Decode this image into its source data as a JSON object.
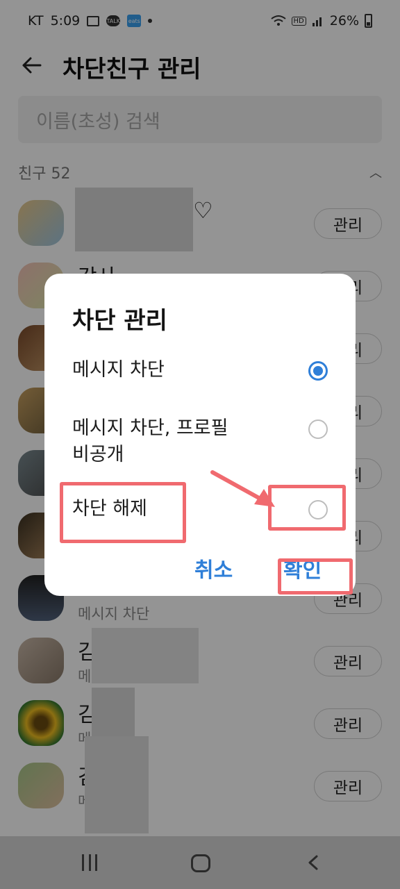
{
  "status_bar": {
    "carrier": "KT",
    "time": "5:09",
    "notification_icons": [
      "image-icon",
      "kakaotalk-icon",
      "eats-icon"
    ],
    "talk_label": "TALK",
    "eats_label": "eats",
    "hd_label": "HD",
    "battery": "26%"
  },
  "app_bar": {
    "title": "차단친구 관리",
    "back_icon": "back-arrow-icon"
  },
  "search": {
    "placeholder": "이름(초성) 검색"
  },
  "friends_section": {
    "label": "친구 52",
    "collapse_icon": "chevron-up-icon"
  },
  "friends": [
    {
      "name": "",
      "subtitle": "",
      "button": "관리"
    },
    {
      "name": "강사",
      "subtitle": "",
      "button": "관리"
    },
    {
      "name": "",
      "subtitle": "",
      "button": "관리"
    },
    {
      "name": "",
      "subtitle": "",
      "button": "관리"
    },
    {
      "name": "",
      "subtitle": "",
      "button": "관리"
    },
    {
      "name": "",
      "subtitle": "",
      "button": "관리"
    },
    {
      "name": "",
      "subtitle": "메시지 차단",
      "button": "관리"
    },
    {
      "name": "김",
      "subtitle": "메",
      "button": "관리"
    },
    {
      "name": "김",
      "subtitle": "메",
      "button": "관리"
    },
    {
      "name": "김",
      "subtitle": "메",
      "button": "관리"
    }
  ],
  "dialog": {
    "title": "차단 관리",
    "options": [
      {
        "label": "메시지 차단",
        "selected": true
      },
      {
        "label_line1": "메시지 차단, 프로필",
        "label_line2": "비공개",
        "selected": false
      },
      {
        "label": "차단 해제",
        "selected": false
      }
    ],
    "cancel": "취소",
    "confirm": "확인"
  },
  "colors": {
    "accent": "#2f7fd8",
    "annotation": "#f06a6f"
  },
  "nav_bar": {
    "icons": [
      "recent-apps-icon",
      "home-icon",
      "back-icon"
    ]
  }
}
